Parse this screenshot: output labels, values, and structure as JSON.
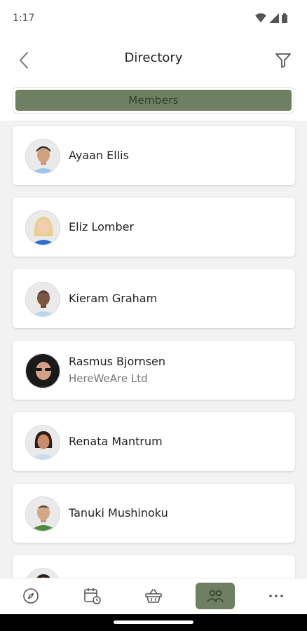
{
  "status_bar": {
    "time": "1:17",
    "icons": [
      "wifi-icon",
      "signal-icon",
      "battery-icon"
    ]
  },
  "header": {
    "title": "Directory",
    "back_icon": "chevron-left-icon",
    "filter_icon": "filter-icon"
  },
  "segment": {
    "label": "Members"
  },
  "members": [
    {
      "name": "Ayaan Ellis",
      "subtitle": ""
    },
    {
      "name": "Eliz Lomber",
      "subtitle": ""
    },
    {
      "name": "Kieram Graham",
      "subtitle": ""
    },
    {
      "name": "Rasmus Bjornsen",
      "subtitle": "HereWeAre Ltd"
    },
    {
      "name": "Renata Mantrum",
      "subtitle": ""
    },
    {
      "name": "Tanuki Mushinoku",
      "subtitle": ""
    },
    {
      "name": "",
      "subtitle": ""
    }
  ],
  "bottom_nav": {
    "items": [
      {
        "icon": "compass-icon",
        "active": false
      },
      {
        "icon": "calendar-clock-icon",
        "active": false
      },
      {
        "icon": "basket-icon",
        "active": false
      },
      {
        "icon": "people-icon",
        "active": true
      },
      {
        "icon": "more-icon",
        "active": false
      }
    ]
  },
  "colors": {
    "accent": "#6f8062",
    "accent_text": "#2c4224",
    "background": "#f2f2f2",
    "card": "#ffffff"
  }
}
